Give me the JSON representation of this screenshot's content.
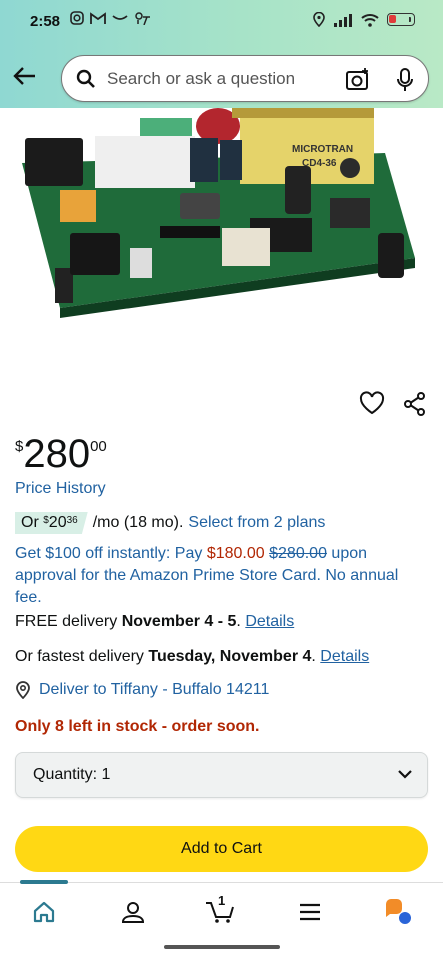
{
  "status_bar": {
    "time": "2:58",
    "left_icons": [
      "instagram-icon",
      "gmail-icon",
      "amazon-smile-icon",
      "weather-icon"
    ],
    "right_icons": [
      "location-icon",
      "signal-icon",
      "wifi-icon",
      "battery-icon"
    ]
  },
  "search": {
    "placeholder": "Search or ask a question"
  },
  "product": {
    "image_labels": [
      "MICROTRAN",
      "CD4-36"
    ],
    "price_symbol": "$",
    "price_whole": "280",
    "price_fraction": "00",
    "price_history": "Price History",
    "installment": {
      "prefix": "Or",
      "symbol": "$",
      "whole": "20",
      "fraction": "36",
      "terms": "/mo (18 mo).",
      "link": "Select from 2 plans"
    },
    "promo": {
      "text_before": "Get $100 off instantly: Pay ",
      "new_price": "$180.00",
      "old_price": "$280.00",
      "text_after": " upon approval for the Amazon Prime Store Card. No annual fee."
    },
    "free_delivery": {
      "prefix": "FREE delivery ",
      "dates": "November 4 - 5",
      "sep": ". ",
      "link": "Details"
    },
    "fastest_delivery": {
      "prefix": "Or fastest delivery ",
      "date": "Tuesday, November 4",
      "sep": ". ",
      "link": "Details"
    },
    "deliver_to": "Deliver to Tiffany - Buffalo 14211",
    "stock": "Only 8 left in stock - order soon.",
    "quantity_label": "Quantity: 1",
    "add_to_cart": "Add to Cart"
  },
  "bottom_nav": {
    "items": [
      "home-icon",
      "account-icon",
      "cart-icon",
      "menu-icon",
      "rufus-icon"
    ],
    "cart_count": "1"
  },
  "colors": {
    "link": "#2162a1",
    "deal_red": "#b12704",
    "add_to_cart": "#ffd814",
    "header_gradient_start": "#8fd8d2",
    "header_gradient_end": "#b9e9c6"
  }
}
